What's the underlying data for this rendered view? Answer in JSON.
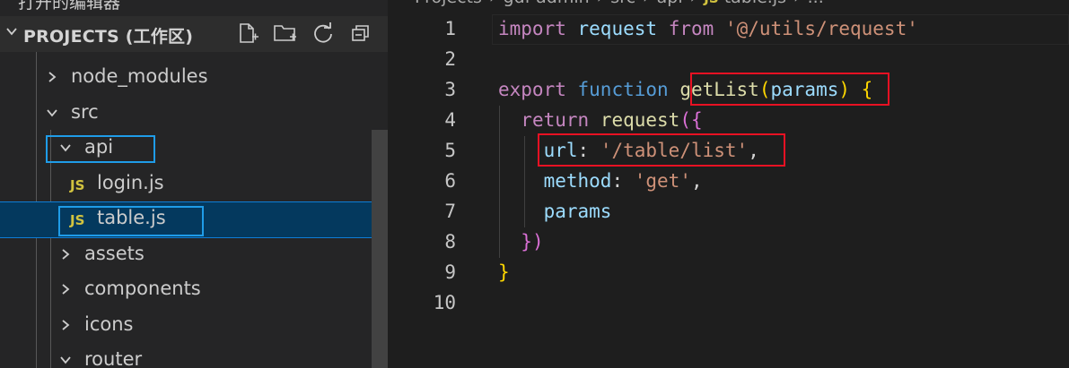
{
  "sidebar": {
    "top_cut_title": "打开的编辑器",
    "section_title": "PROJECTS (工作区)",
    "actions": [
      {
        "icon": "new-file-icon"
      },
      {
        "icon": "new-folder-icon"
      },
      {
        "icon": "refresh-icon"
      },
      {
        "icon": "collapse-all-icon"
      }
    ],
    "tree": [
      {
        "label": "node_modules",
        "type": "folder",
        "expanded": false
      },
      {
        "label": "src",
        "type": "folder",
        "expanded": true
      },
      {
        "label": "api",
        "type": "folder",
        "expanded": true
      },
      {
        "label": "login.js",
        "type": "file",
        "badge": "JS"
      },
      {
        "label": "table.js",
        "type": "file",
        "badge": "JS",
        "selected": true
      },
      {
        "label": "assets",
        "type": "folder",
        "expanded": false
      },
      {
        "label": "components",
        "type": "folder",
        "expanded": false
      },
      {
        "label": "icons",
        "type": "folder",
        "expanded": false
      },
      {
        "label": "router",
        "type": "folder",
        "expanded": true
      }
    ]
  },
  "breadcrumb": {
    "items": [
      "Projects",
      "gdf-admin",
      "src",
      "api"
    ],
    "file_badge": "JS",
    "file": "table.js",
    "more": "..."
  },
  "editor": {
    "line_numbers": [
      "1",
      "2",
      "3",
      "4",
      "5",
      "6",
      "7",
      "8",
      "9",
      "10"
    ]
  },
  "colors": {
    "keyword_control": "#c586c0",
    "keyword_storage": "#569cd6",
    "function": "#dcdcaa",
    "variable": "#9cdcfe",
    "string": "#ce9178",
    "js_badge": "#d2c33f",
    "selection": "#04395e",
    "annotation_blue": "#1f9ce8",
    "annotation_red": "#e81123"
  }
}
